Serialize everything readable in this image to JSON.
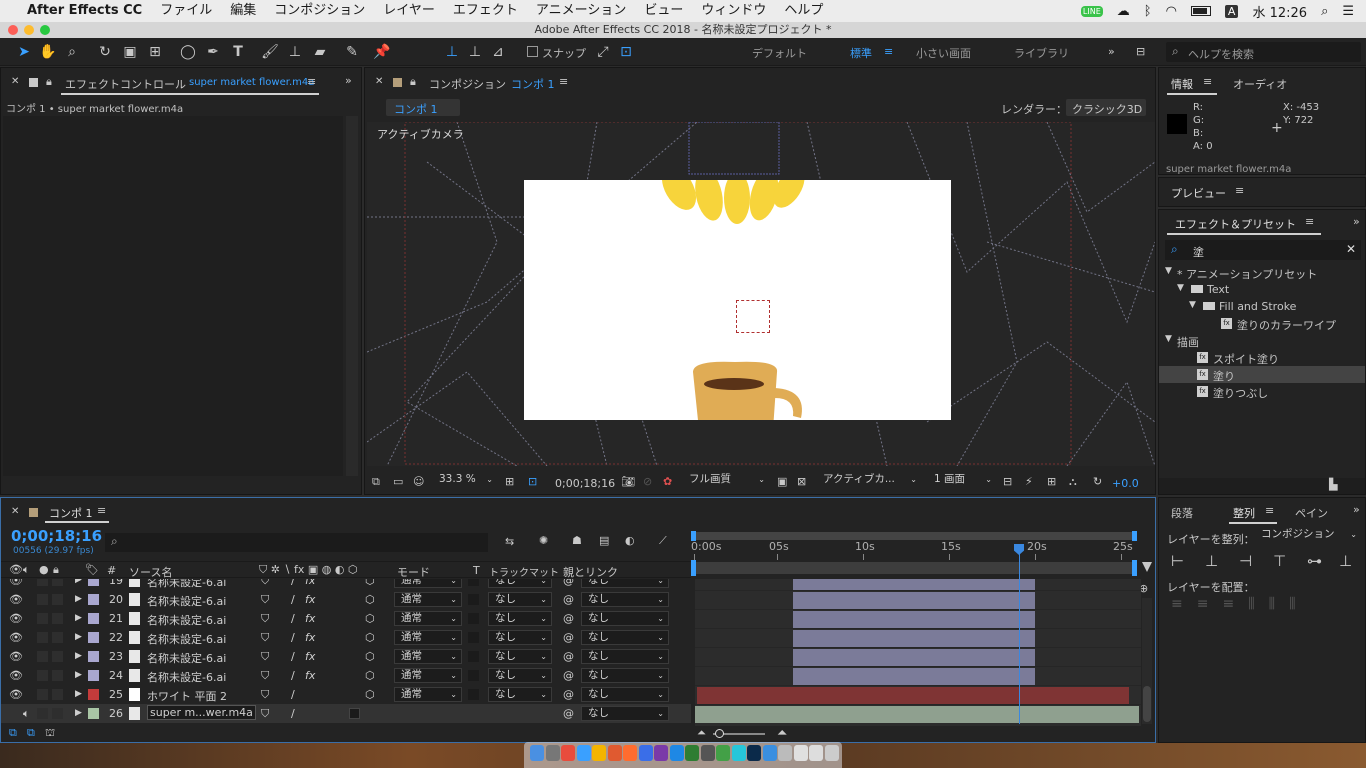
{
  "menubar": {
    "app": "After Effects CC",
    "items": [
      "ファイル",
      "編集",
      "コンポジション",
      "レイヤー",
      "エフェクト",
      "アニメーション",
      "ビュー",
      "ウィンドウ",
      "ヘルプ"
    ],
    "clock": "水 12:26",
    "input_mode": "A"
  },
  "window": {
    "title": "Adobe After Effects CC 2018 - 名称未設定プロジェクト *"
  },
  "toolbar": {
    "snap_label": "スナップ",
    "workspaces": [
      "デフォルト",
      "標準",
      "小さい画面",
      "ライブラリ"
    ],
    "active_workspace": "標準",
    "help_placeholder": "ヘルプを検索"
  },
  "effect_controls": {
    "title": "エフェクトコントロール",
    "file": "super market flower.m4a",
    "breadcrumb": "コンポ 1 • super market flower.m4a"
  },
  "composition": {
    "title": "コンポジション",
    "comp_name": "コンポ 1",
    "tab": "コンポ 1",
    "renderer_label": "レンダラー：",
    "renderer": "クラシック3D",
    "camera_label": "アクティブカメラ",
    "zoom": "33.3 %",
    "timecode": "0;00;18;16",
    "quality": "フル画質",
    "view": "アクティブカ...",
    "views_count": "1 画面",
    "exposure": "+0.0"
  },
  "info": {
    "tab_info": "情報",
    "tab_audio": "オーディオ",
    "r": "R:",
    "g": "G:",
    "b": "B:",
    "a": "A:  0",
    "x": "X: -453",
    "y": "Y:  722",
    "file": "super market flower.m4a"
  },
  "preview": {
    "title": "プレビュー"
  },
  "effects": {
    "title": "エフェクト＆プリセット",
    "search": "塗",
    "tree": [
      {
        "label": "* アニメーションプリセット",
        "depth": 0,
        "type": "folder"
      },
      {
        "label": "Text",
        "depth": 1,
        "type": "folder"
      },
      {
        "label": "Fill and Stroke",
        "depth": 2,
        "type": "folder"
      },
      {
        "label": "塗りのカラーワイプ",
        "depth": 3,
        "type": "item"
      },
      {
        "label": "描画",
        "depth": 0,
        "type": "group"
      },
      {
        "label": "スポイト塗り",
        "depth": 1,
        "type": "item"
      },
      {
        "label": "塗り",
        "depth": 1,
        "type": "item",
        "selected": true
      },
      {
        "label": "塗りつぶし",
        "depth": 1,
        "type": "item"
      }
    ]
  },
  "align": {
    "tab_para": "段落",
    "tab_align": "整列",
    "tab_paint": "ペイン",
    "align_to_label": "レイヤーを整列：",
    "align_to": "コンポジション",
    "distribute_label": "レイヤーを配置："
  },
  "timeline": {
    "title": "コンポ 1",
    "timecode": "0;00;18;16",
    "frames": "00556 (29.97 fps)",
    "search_placeholder": "",
    "headers": {
      "num": "#",
      "source": "ソース名",
      "mode": "モード",
      "t": "T",
      "trackmatte": "トラックマット",
      "parent": "親とリンク"
    },
    "ticks": [
      "0:00s",
      "05s",
      "10s",
      "15s",
      "20s",
      "25s"
    ],
    "layers": [
      {
        "num": "19",
        "name": "名称未設定-6.ai",
        "mode": "通常",
        "track": "なし",
        "parent": "なし",
        "color": "#a9a7cf",
        "partial": true
      },
      {
        "num": "20",
        "name": "名称未設定-6.ai",
        "mode": "通常",
        "track": "なし",
        "parent": "なし",
        "color": "#a9a7cf"
      },
      {
        "num": "21",
        "name": "名称未設定-6.ai",
        "mode": "通常",
        "track": "なし",
        "parent": "なし",
        "color": "#a9a7cf"
      },
      {
        "num": "22",
        "name": "名称未設定-6.ai",
        "mode": "通常",
        "track": "なし",
        "parent": "なし",
        "color": "#a9a7cf"
      },
      {
        "num": "23",
        "name": "名称未設定-6.ai",
        "mode": "通常",
        "track": "なし",
        "parent": "なし",
        "color": "#a9a7cf"
      },
      {
        "num": "24",
        "name": "名称未設定-6.ai",
        "mode": "通常",
        "track": "なし",
        "parent": "なし",
        "color": "#a9a7cf"
      },
      {
        "num": "25",
        "name": "ホワイト 平面 2",
        "mode": "通常",
        "track": "なし",
        "parent": "なし",
        "color": "#c43b3b"
      },
      {
        "num": "26",
        "name": "super m...wer.m4a",
        "mode": "",
        "track": "",
        "parent": "なし",
        "color": "#a9c5a5",
        "audio": true
      }
    ]
  },
  "colors": {
    "accent": "#3aa0ff",
    "layer_bar": "#7b7b99",
    "solid_bar": "#7f3434",
    "audio_bar": "#8fa08f"
  }
}
